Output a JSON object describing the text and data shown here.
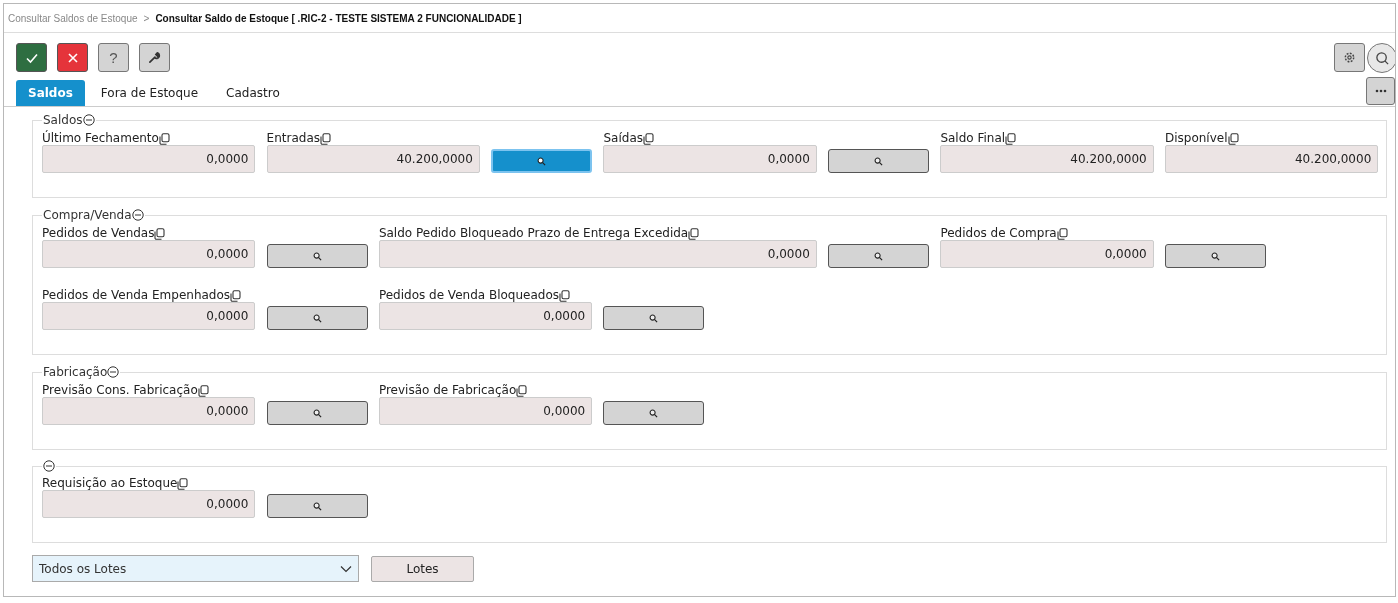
{
  "breadcrumb": {
    "parent": "Consultar Saldos de Estoque",
    "separator": ">",
    "current": "Consultar Saldo de Estoque [ .RIC-2 - TESTE SISTEMA 2 FUNCIONALIDADE ]"
  },
  "toolbar": [
    {
      "kind": "confirm"
    },
    {
      "kind": "cancel"
    },
    {
      "kind": "help",
      "label": "?"
    },
    {
      "kind": "tools"
    }
  ],
  "tabs": [
    {
      "label": "Saldos",
      "selected": true
    },
    {
      "label": "Fora de Estoque",
      "selected": false
    },
    {
      "label": "Cadastro",
      "selected": false
    }
  ],
  "groups": [
    {
      "title": "Saldos",
      "items": [
        {
          "kind": "field",
          "label": "Último Fechamento",
          "value": "0,0000"
        },
        {
          "kind": "field",
          "label": "Entradas",
          "value": "40.200,0000"
        },
        {
          "kind": "lookup",
          "selected": true
        },
        {
          "kind": "field",
          "label": "Saídas",
          "value": "0,0000"
        },
        {
          "kind": "lookup",
          "selected": false
        },
        {
          "kind": "field",
          "label": "Saldo Final",
          "value": "40.200,0000"
        },
        {
          "kind": "field",
          "label": "Disponível",
          "value": "40.200,0000"
        }
      ]
    },
    {
      "title": "Compra/Venda",
      "items": [
        {
          "kind": "field",
          "label": "Pedidos de Vendas",
          "value": "0,0000"
        },
        {
          "kind": "lookup",
          "selected": false
        },
        {
          "kind": "wide-field",
          "label": "Saldo Pedido Bloqueado Prazo de Entrega Excedida",
          "value": "0,0000"
        },
        {
          "kind": "lookup",
          "selected": false
        },
        {
          "kind": "field",
          "label": "Pedidos de Compra",
          "value": "0,0000"
        },
        {
          "kind": "lookup",
          "selected": false
        },
        {
          "kind": "break"
        },
        {
          "kind": "field",
          "label": "Pedidos de Venda Empenhados",
          "value": "0,0000"
        },
        {
          "kind": "lookup",
          "selected": false
        },
        {
          "kind": "field",
          "label": "Pedidos de Venda Bloqueados",
          "value": "0,0000"
        },
        {
          "kind": "lookup",
          "selected": false
        }
      ]
    },
    {
      "title": "Fabricação",
      "items": [
        {
          "kind": "field",
          "label": "Previsão Cons. Fabricação",
          "value": "0,0000"
        },
        {
          "kind": "lookup",
          "selected": false
        },
        {
          "kind": "field",
          "label": "Previsão de Fabricação",
          "value": "0,0000"
        },
        {
          "kind": "lookup",
          "selected": false
        }
      ]
    },
    {
      "items": [
        {
          "kind": "field",
          "label": "Requisição ao Estoque",
          "value": "0,0000"
        },
        {
          "kind": "lookup",
          "selected": false
        }
      ]
    }
  ],
  "lot_select": {
    "value": "Todos os Lotes"
  },
  "lots_button": {
    "label": "Lotes"
  }
}
